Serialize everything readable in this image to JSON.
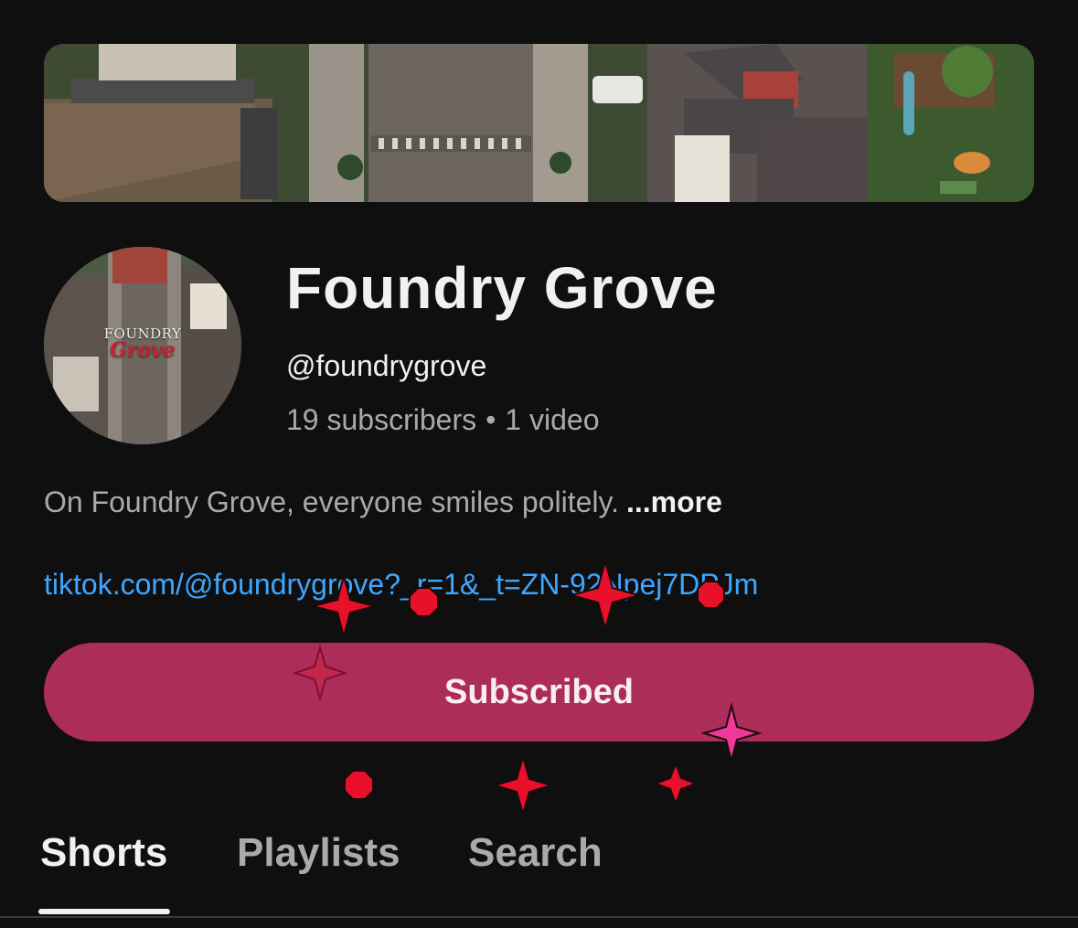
{
  "channel": {
    "name": "Foundry Grove",
    "handle": "@foundrygrove",
    "subscribers": "19 subscribers",
    "separator": "•",
    "videos": "1 video",
    "description": "On Foundry Grove, everyone smiles politely.",
    "more_label": "...more",
    "link": "tiktok.com/@foundrygrove?_r=1&_t=ZN-92Npej7DPJm",
    "avatar_logo_top": "FOUNDRY",
    "avatar_logo_bottom": "Grove"
  },
  "subscribe_button": {
    "label": "Subscribed",
    "color": "#ac2c5a"
  },
  "tabs": [
    {
      "label": "Shorts",
      "active": true
    },
    {
      "label": "Playlists",
      "active": false
    },
    {
      "label": "Search",
      "active": false
    }
  ],
  "theme": {
    "background": "#0f0f0f",
    "primary_text": "#f1f1f1",
    "secondary_text": "#aaaaaa",
    "link": "#3ea6ff"
  },
  "banner_image": "aerial-neighborhood-street-image",
  "overlay_markers": [
    "red-four-point-star",
    "red-octagon",
    "pink-four-point-star"
  ]
}
